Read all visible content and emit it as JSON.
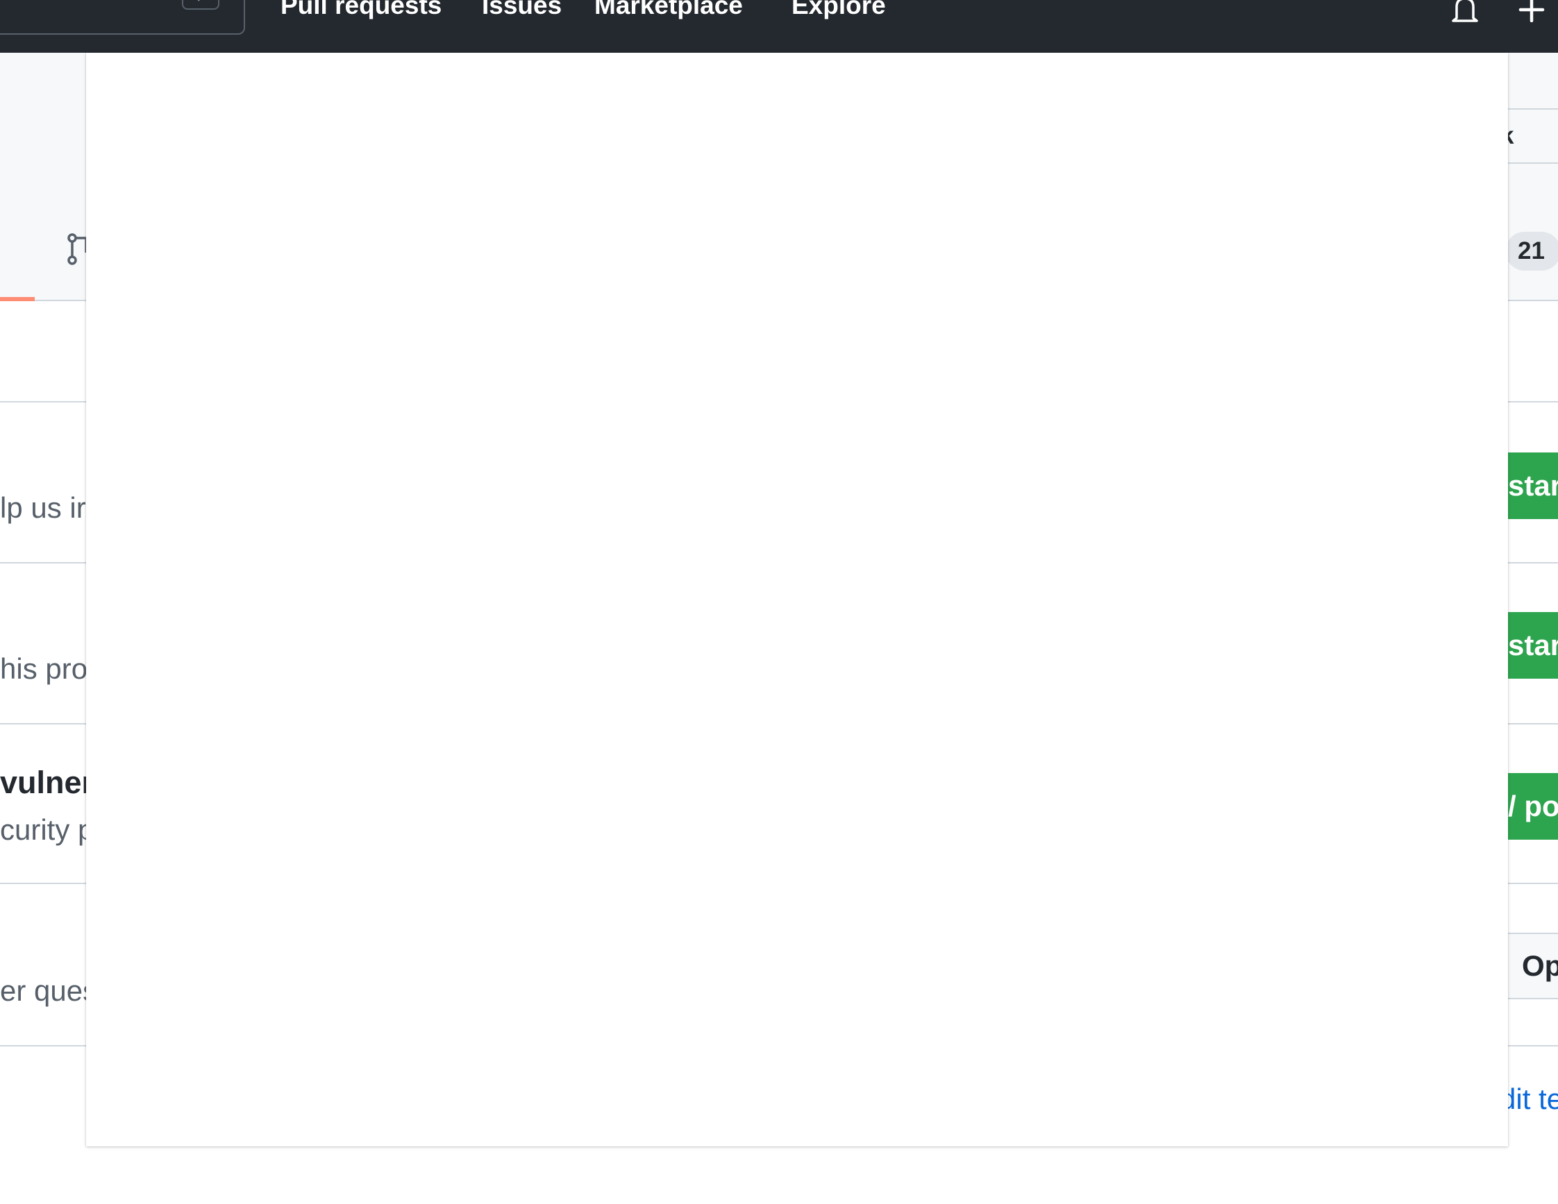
{
  "header": {
    "search_shortcut": "/",
    "nav": {
      "pull_requests": "Pull requests",
      "issues": "Issues",
      "marketplace": "Marketplace",
      "explore": "Explore"
    },
    "icons": [
      "bell-icon",
      "plus-icon"
    ]
  },
  "repo": {
    "fork_label": "ork",
    "tab_count": "21"
  },
  "rows": [
    {
      "description": "lp us ir",
      "button_label": "star"
    },
    {
      "description": "his proj",
      "button_label": "star"
    },
    {
      "title": "vulner",
      "description": "curity p",
      "button_label": "/ po"
    },
    {
      "description": "er ques",
      "button_label": "Op"
    }
  ],
  "footer": {
    "edit_link": "dit te"
  },
  "colors": {
    "header_bg": "#24292f",
    "green": "#2da44e",
    "tab_underline": "#fd8c73",
    "link": "#0969da"
  }
}
